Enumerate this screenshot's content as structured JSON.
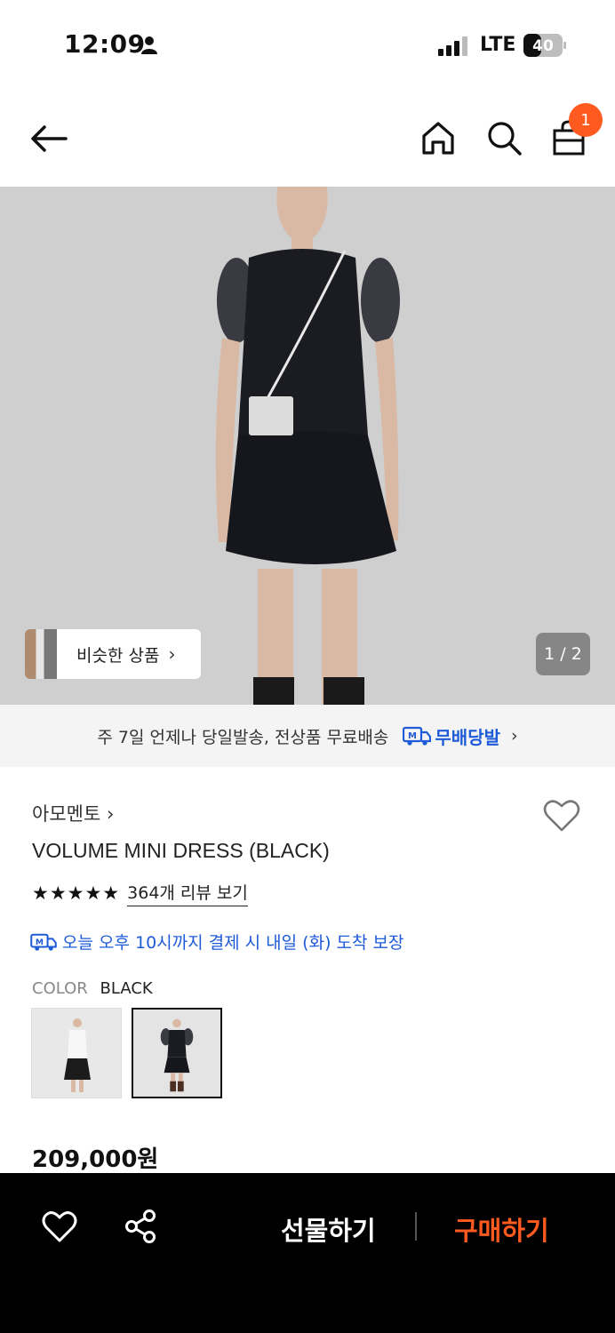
{
  "status_bar": {
    "time": "12:09",
    "network": "LTE",
    "battery": "40"
  },
  "header": {
    "cart_count": "1"
  },
  "gallery": {
    "similar_label": "비슷한 상품",
    "pager": "1 / 2"
  },
  "shipping_banner": {
    "text": "주 7일 언제나 당일발송, 전상품 무료배송",
    "brand": "무배당발"
  },
  "product": {
    "store": "아모멘토",
    "title": "VOLUME MINI DRESS (BLACK)",
    "rating_stars": 5,
    "review_link": "364개 리뷰 보기",
    "delivery_note": "오늘 오후 10시까지 결제 시 내일 (화) 도착 보장",
    "color_label": "COLOR",
    "color_value": "BLACK",
    "price": "209,000원"
  },
  "bottom_bar": {
    "gift_label": "선물하기",
    "buy_label": "구매하기"
  },
  "colors": {
    "accent": "#ff5a1f",
    "link_blue": "#1e5bd8"
  },
  "icons": [
    "person-icon",
    "signal-icon",
    "battery-icon",
    "back-arrow-icon",
    "home-icon",
    "search-icon",
    "shopping-bag-icon",
    "chevron-right-icon",
    "delivery-truck-icon",
    "heart-icon",
    "share-icon",
    "star-icon"
  ]
}
